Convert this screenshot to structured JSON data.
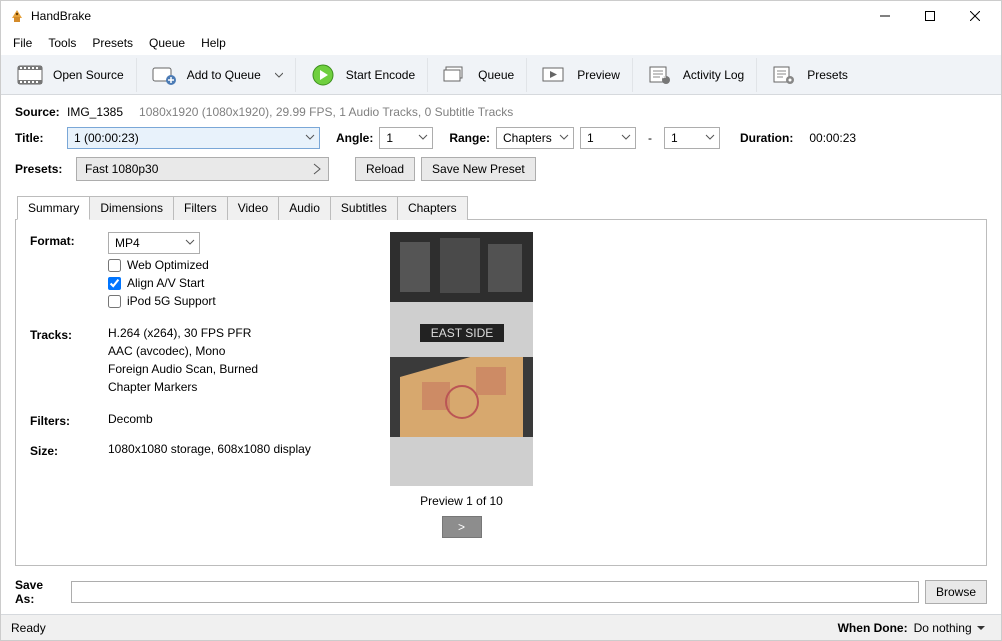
{
  "app": {
    "title": "HandBrake"
  },
  "menu": {
    "file": "File",
    "tools": "Tools",
    "presets": "Presets",
    "queue": "Queue",
    "help": "Help"
  },
  "toolbar": {
    "open_source": "Open Source",
    "add_to_queue": "Add to Queue",
    "start_encode": "Start Encode",
    "queue": "Queue",
    "preview": "Preview",
    "activity_log": "Activity Log",
    "presets": "Presets"
  },
  "source": {
    "label": "Source:",
    "name": "IMG_1385",
    "meta": "1080x1920 (1080x1920), 29.99 FPS, 1 Audio Tracks, 0 Subtitle Tracks"
  },
  "title_row": {
    "label": "Title:",
    "selected": "1 (00:00:23)",
    "angle_label": "Angle:",
    "angle_value": "1",
    "range_label": "Range:",
    "range_mode": "Chapters",
    "range_from": "1",
    "range_to": "1",
    "duration_label": "Duration:",
    "duration_value": "00:00:23"
  },
  "presets": {
    "label": "Presets:",
    "selected": "Fast 1080p30",
    "reload": "Reload",
    "save_new": "Save New Preset"
  },
  "tabs": {
    "summary": "Summary",
    "dimensions": "Dimensions",
    "filters": "Filters",
    "video": "Video",
    "audio": "Audio",
    "subtitles": "Subtitles",
    "chapters": "Chapters"
  },
  "summary": {
    "format_label": "Format:",
    "format_value": "MP4",
    "web_optimized": "Web Optimized",
    "align_av": "Align A/V Start",
    "ipod": "iPod 5G Support",
    "tracks_label": "Tracks:",
    "tracks": {
      "l1": "H.264 (x264), 30 FPS PFR",
      "l2": "AAC (avcodec), Mono",
      "l3": "Foreign Audio Scan, Burned",
      "l4": "Chapter Markers"
    },
    "filters_label": "Filters:",
    "filters_value": "Decomb",
    "size_label": "Size:",
    "size_value": "1080x1080 storage, 608x1080 display",
    "preview_caption": "Preview 1 of 10",
    "preview_next": ">"
  },
  "save": {
    "label": "Save As:",
    "value": "",
    "browse": "Browse"
  },
  "status": {
    "ready": "Ready",
    "when_done_label": "When Done:",
    "when_done_value": "Do nothing"
  }
}
